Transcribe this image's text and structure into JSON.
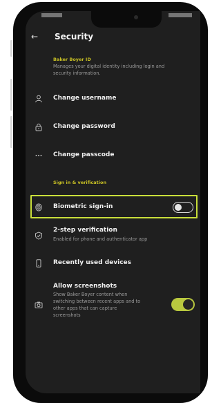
{
  "header": {
    "back_icon": "arrow-left-icon",
    "title": "Security"
  },
  "account": {
    "section_label": "Baker Boyer ID",
    "description_line1": "Manages your digital identity including login and",
    "description_line2": "security information."
  },
  "account_rows": [
    {
      "label": "Change username",
      "icon": "person-icon"
    },
    {
      "label": "Change password",
      "icon": "lock-icon"
    },
    {
      "label": "Change passcode",
      "icon": "dots-icon"
    }
  ],
  "signin": {
    "section_label": "Sign in & verification",
    "biometric": {
      "label": "Biometric sign-in",
      "icon": "fingerprint-icon",
      "enabled": false
    },
    "two_step": {
      "label": "2-step verification",
      "description": "Enabled for phone and authenticator app",
      "icon": "shield-check-icon"
    },
    "recent_devices": {
      "label": "Recently used devices",
      "icon": "phone-icon"
    },
    "screenshots": {
      "label": "Allow screenshots",
      "description_lines": [
        "Show Baker Boyer content when",
        "switching between recent apps and to",
        "other apps that can capture",
        "screenshots"
      ],
      "icon": "camera-icon",
      "enabled": true
    }
  },
  "colors": {
    "accent": "#c9df3a",
    "section_label": "#c8c024",
    "background": "#1f1f1f",
    "toggle_on": "#b9c83f"
  }
}
